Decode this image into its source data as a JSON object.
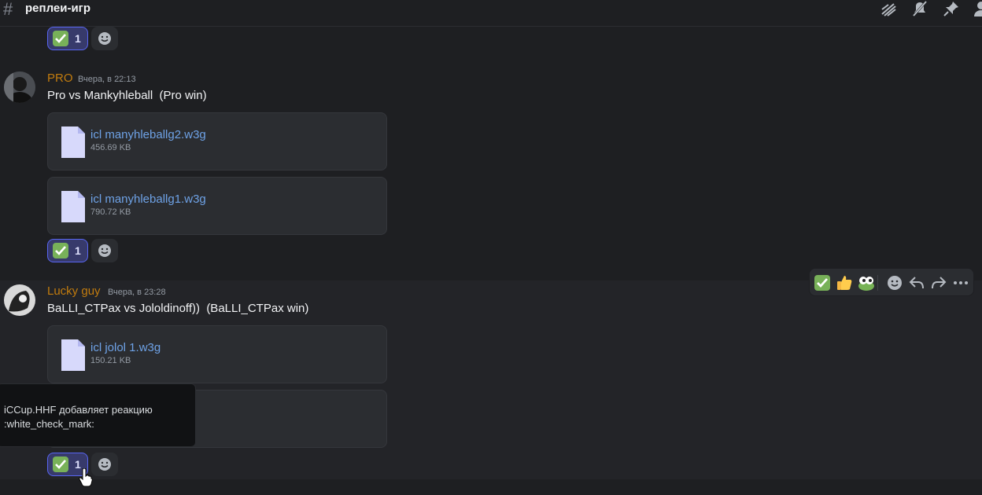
{
  "channel": {
    "name": "реплеи-игр"
  },
  "header_icons": [
    "threads-icon",
    "mute-icon",
    "pin-icon",
    "members-icon"
  ],
  "top_reaction": {
    "emoji": "white-check-mark-icon",
    "count": "1"
  },
  "messages": [
    {
      "author": "PRO",
      "timestamp": "Вчера, в 22:13",
      "text": "Pro vs Mankyhleball  (Pro win)",
      "attachments": [
        {
          "name": "icl manyhleballg2.w3g",
          "size": "456.69 KB"
        },
        {
          "name": "icl manyhleballg1.w3g",
          "size": "790.72 KB"
        }
      ],
      "reaction": {
        "emoji": "white-check-mark-icon",
        "count": "1"
      }
    },
    {
      "author": "Lucky guy",
      "timestamp": "Вчера, в 23:28",
      "text": "BaLLI_CTPax vs Jololdinoff))  (BaLLI_CTPax win)",
      "attachments": [
        {
          "name": "icl jolol 1.w3g",
          "size": "150.21 KB"
        },
        {
          "name": "",
          "size": ""
        }
      ],
      "reaction": {
        "emoji": "white-check-mark-icon",
        "count": "1"
      }
    }
  ],
  "toolbar": [
    "white-check-mark-icon",
    "thumbs-up-icon",
    "frog-eyes-icon",
    "add-reaction-icon",
    "reply-icon",
    "forward-icon",
    "more-icon"
  ],
  "tooltip": {
    "line1": "iCCup.HHF добавляет реакцию",
    "line2": ":white_check_mark:"
  },
  "colors": {
    "author": "#c27c0e",
    "link": "#6ea2e6",
    "reaction_bg": "#373a6b",
    "reaction_border": "#5865f2",
    "background": "#1e1f22"
  }
}
